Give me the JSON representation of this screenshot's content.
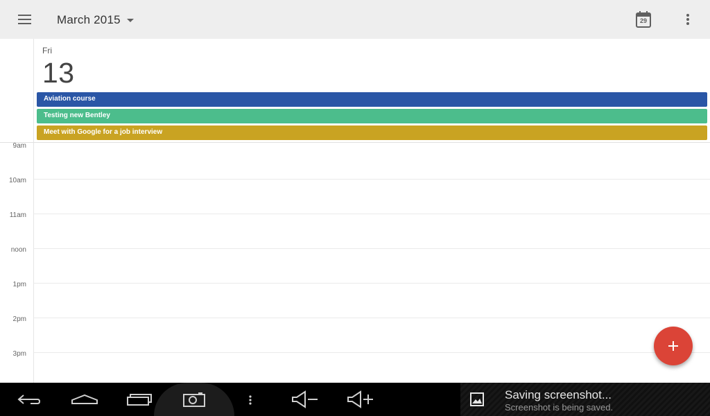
{
  "appbar": {
    "month_label": "March 2015",
    "today_date": "29"
  },
  "day": {
    "weekday": "Fri",
    "date": "13"
  },
  "events": [
    {
      "title": "Aviation course",
      "color": "#2a56a6"
    },
    {
      "title": "Testing new Bentley",
      "color": "#4cbd8c"
    },
    {
      "title": "Meet with Google for a job interview",
      "color": "#c9a322"
    }
  ],
  "hours": [
    "9am",
    "10am",
    "11am",
    "noon",
    "1pm",
    "2pm",
    "3pm"
  ],
  "fab": {
    "icon": "plus-icon",
    "color": "#db4437"
  },
  "navbar": {
    "buttons": [
      "back-icon",
      "home-icon",
      "recent-apps-icon",
      "screenshot-icon",
      "menu-icon",
      "volume-down-icon",
      "volume-up-icon"
    ]
  },
  "notification": {
    "title": "Saving screenshot...",
    "text": "Screenshot is being saved."
  }
}
